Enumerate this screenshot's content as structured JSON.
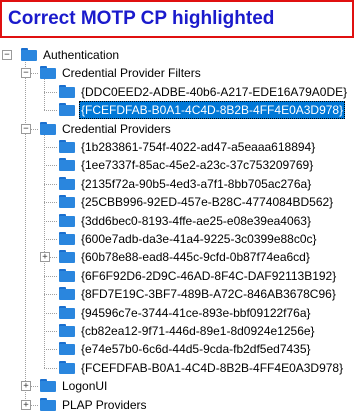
{
  "banner": {
    "text": "Correct MOTP CP highlighted"
  },
  "colors": {
    "banner_border": "#e01010",
    "banner_text": "#1a1acc",
    "selection": "#0078d7",
    "folder": "#2a86de"
  },
  "tree": {
    "root": {
      "label": "Authentication",
      "expander": "−"
    },
    "filters": {
      "label": "Credential Provider Filters",
      "expander": "−",
      "items": [
        {
          "label": "{DDC0EED2-ADBE-40b6-A217-EDE16A79A0DE}"
        },
        {
          "label": "{FCEFDFAB-B0A1-4C4D-8B2B-4FF4E0A3D978}",
          "selected": true
        }
      ]
    },
    "providers": {
      "label": "Credential Providers",
      "expander": "−",
      "items": [
        {
          "label": "{1b283861-754f-4022-ad47-a5eaaa618894}"
        },
        {
          "label": "{1ee7337f-85ac-45e2-a23c-37c753209769}"
        },
        {
          "label": "{2135f72a-90b5-4ed3-a7f1-8bb705ac276a}"
        },
        {
          "label": "{25CBB996-92ED-457e-B28C-4774084BD562}"
        },
        {
          "label": "{3dd6bec0-8193-4ffe-ae25-e08e39ea4063}"
        },
        {
          "label": "{600e7adb-da3e-41a4-9225-3c0399e88c0c}"
        },
        {
          "label": "{60b78e88-ead8-445c-9cfd-0b87f74ea6cd}",
          "expander": "+"
        },
        {
          "label": "{6F6F92D6-2D9C-46AD-8F4C-DAF92113B192}"
        },
        {
          "label": "{8FD7E19C-3BF7-489B-A72C-846AB3678C96}"
        },
        {
          "label": "{94596c7e-3744-41ce-893e-bbf09122f76a}"
        },
        {
          "label": "{cb82ea12-9f71-446d-89e1-8d0924e1256e}"
        },
        {
          "label": "{e74e57b0-6c6d-44d5-9cda-fb2df5ed7435}"
        },
        {
          "label": "{FCEFDFAB-B0A1-4C4D-8B2B-4FF4E0A3D978}"
        }
      ]
    },
    "logonui": {
      "label": "LogonUI",
      "expander": "+"
    },
    "plap": {
      "label": "PLAP Providers",
      "expander": "+"
    }
  }
}
